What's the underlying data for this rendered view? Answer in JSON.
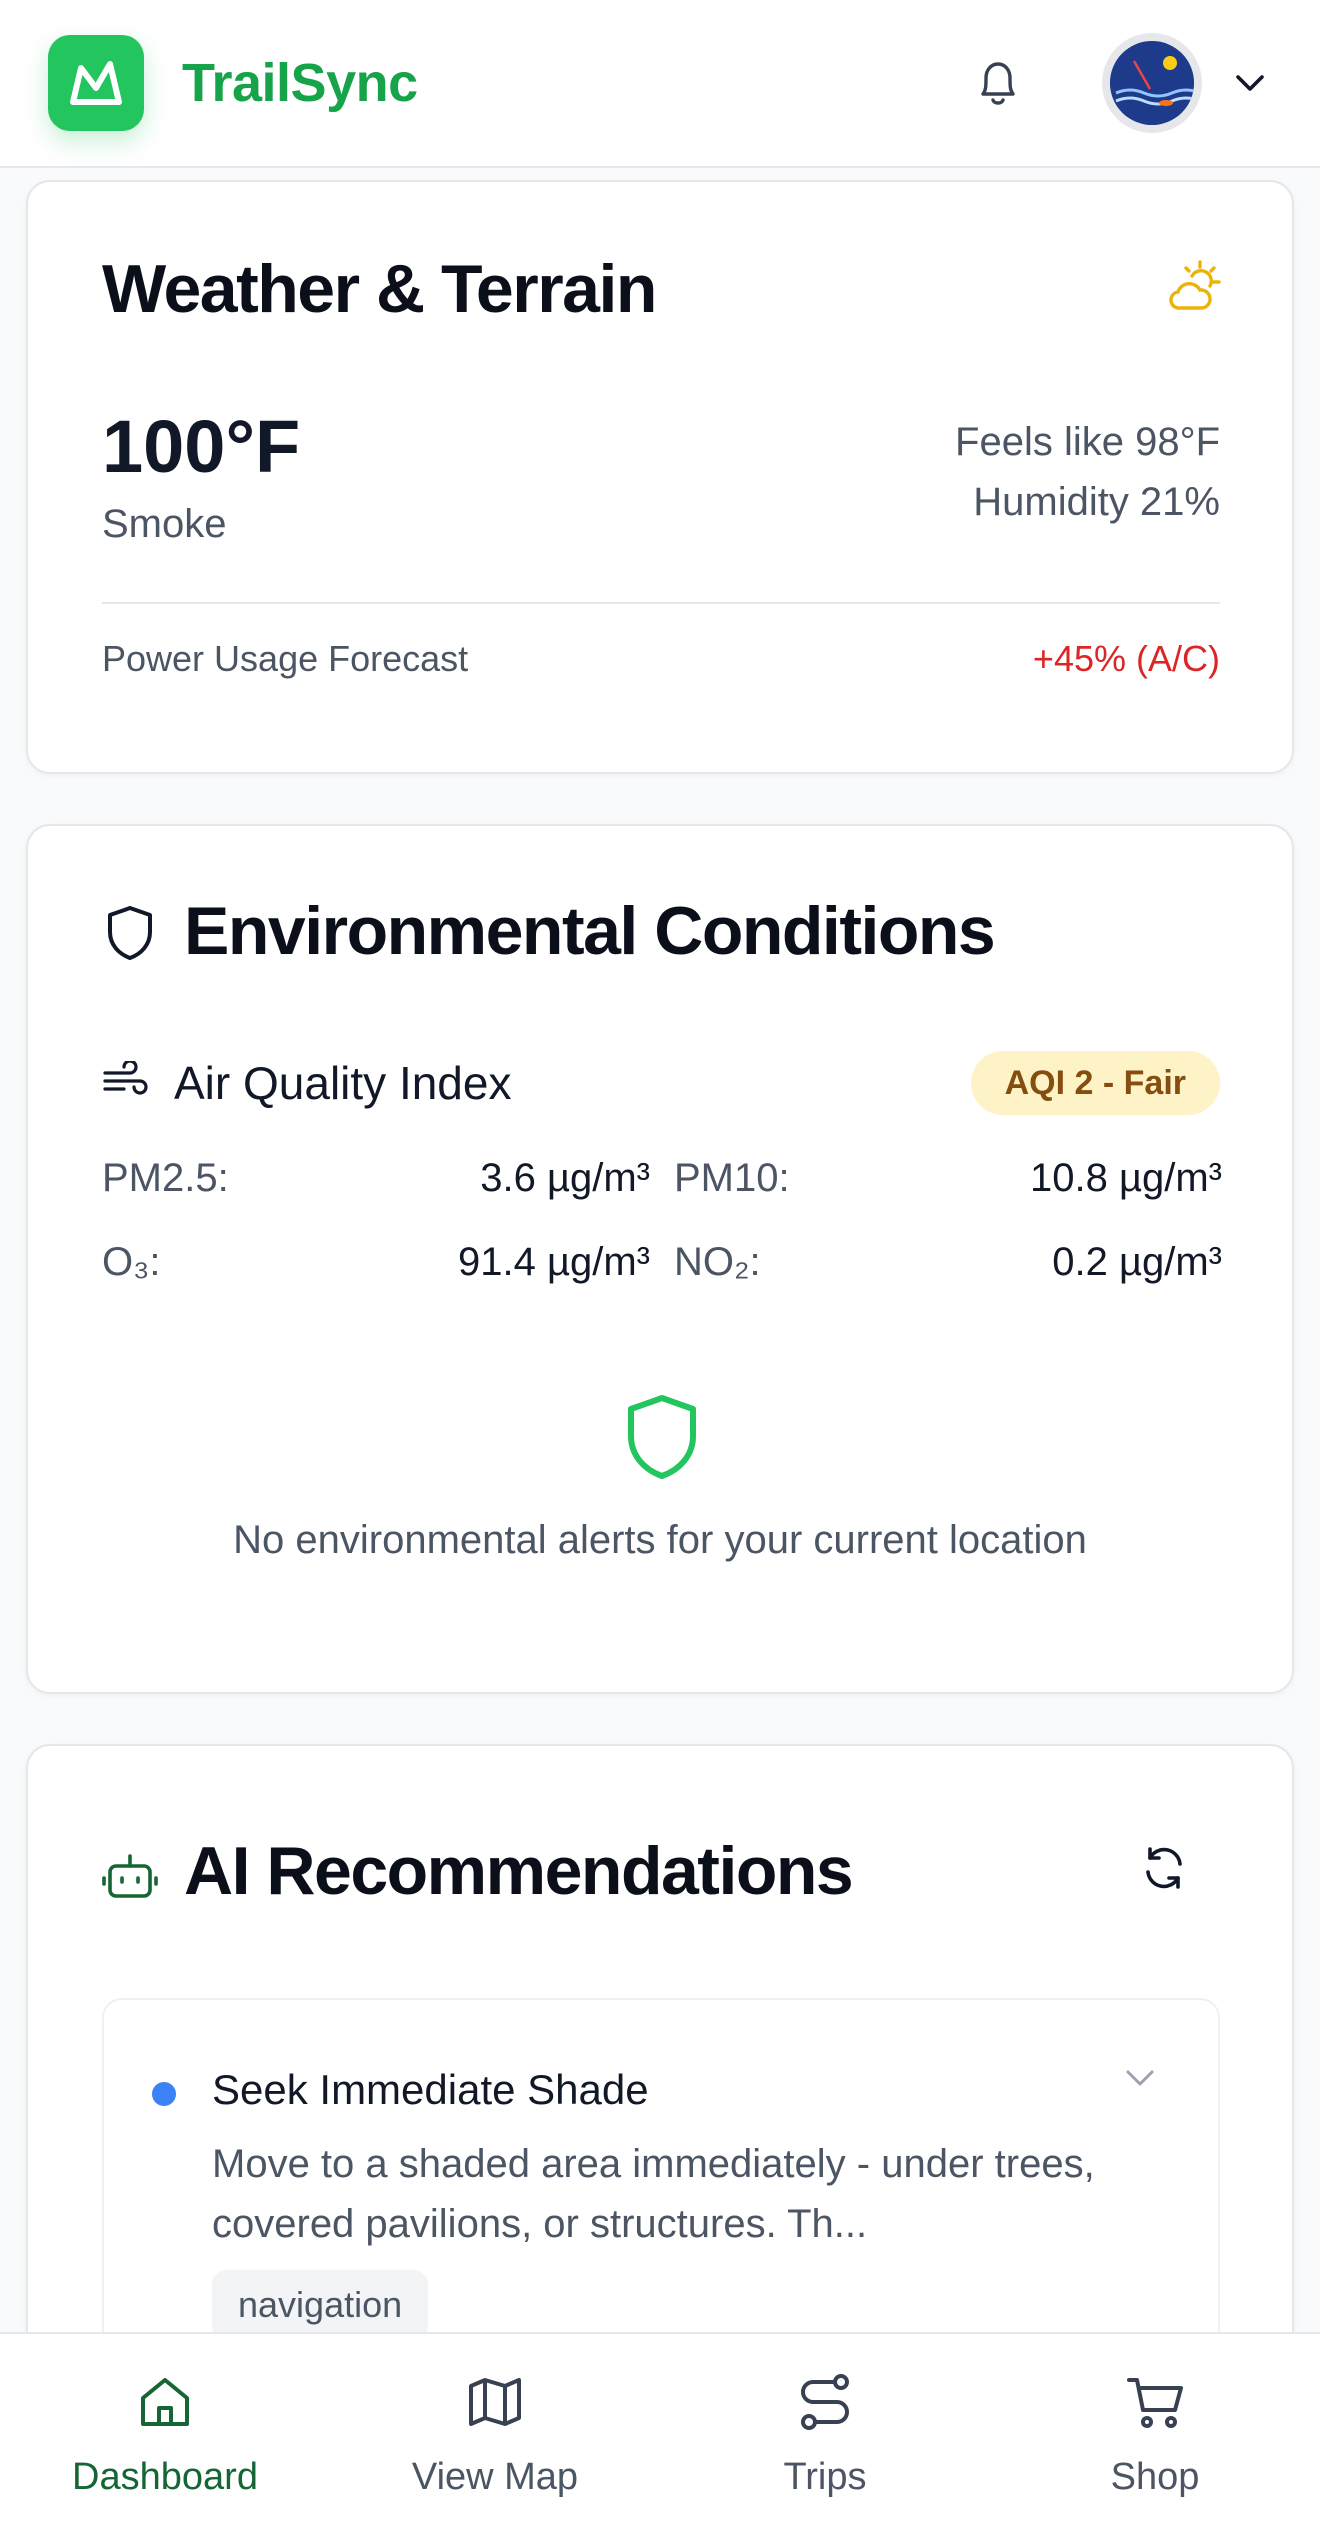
{
  "header": {
    "brand": "TrailSync",
    "logo_icon": "mountain-icon",
    "notification_icon": "bell-icon",
    "avatar_icon": "avatar",
    "menu_icon": "chevron-down-icon"
  },
  "weather": {
    "title": "Weather & Terrain",
    "icon": "partly-sunny-icon",
    "temperature": "100°F",
    "condition": "Smoke",
    "feels_like": "Feels like 98°F",
    "humidity": "Humidity 21%",
    "power_label": "Power Usage Forecast",
    "power_value": "+45% (A/C)"
  },
  "environment": {
    "title": "Environmental Conditions",
    "air_quality": {
      "title": "Air Quality Index",
      "badge": "AQI 2 - Fair",
      "pollutants": [
        {
          "label": "PM2.5:",
          "value": "3.6 µg/m³"
        },
        {
          "label": "PM10:",
          "value": "10.8 µg/m³"
        },
        {
          "label": "O₃:",
          "value": "91.4 µg/m³"
        },
        {
          "label": "NO₂:",
          "value": "0.2 µg/m³"
        }
      ]
    },
    "alert_text": "No environmental alerts for your current location"
  },
  "ai": {
    "title": "AI Recommendations",
    "recommendations": [
      {
        "title": "Seek Immediate Shade",
        "description": "Move to a shaded area immediately - under trees, covered pavilions, or structures. Th...",
        "tag": "navigation"
      }
    ]
  },
  "nav": {
    "items": [
      {
        "label": "Dashboard",
        "icon": "home-icon"
      },
      {
        "label": "View Map",
        "icon": "map-icon"
      },
      {
        "label": "Trips",
        "icon": "route-icon"
      },
      {
        "label": "Shop",
        "icon": "cart-icon"
      }
    ]
  },
  "colors": {
    "brand_green": "#16a34a",
    "logo_green": "#22c55e",
    "alert_red": "#dc2626",
    "badge_yellow": "#fef3c7",
    "dot_blue": "#3b82f6"
  }
}
